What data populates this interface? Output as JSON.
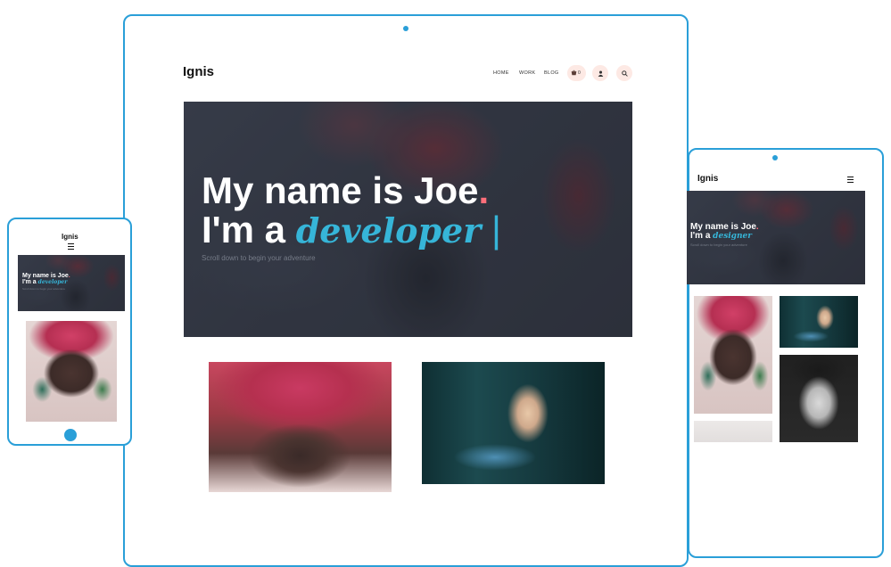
{
  "brand": "Ignis",
  "hero": {
    "line1": "My name is Joe",
    "line1_dot": ".",
    "line2_prefix": "I'm a",
    "role_desktop": "developer",
    "cursor": "|",
    "role_tablet": "designer",
    "subtitle": "Scroll down to begin your adventure"
  },
  "nav": {
    "items": [
      {
        "label": "HOME"
      },
      {
        "label": "WORK"
      },
      {
        "label": "BLOG"
      }
    ],
    "cart_count": "0"
  },
  "icons": {
    "cart": "cart-icon",
    "user": "user-icon",
    "search": "search-icon",
    "menu": "hamburger-menu-icon"
  },
  "colors": {
    "device_outline": "#2a9fd8",
    "accent": "#36b5d8",
    "dot": "#ff6f7a",
    "pill": "#fde9e4"
  }
}
